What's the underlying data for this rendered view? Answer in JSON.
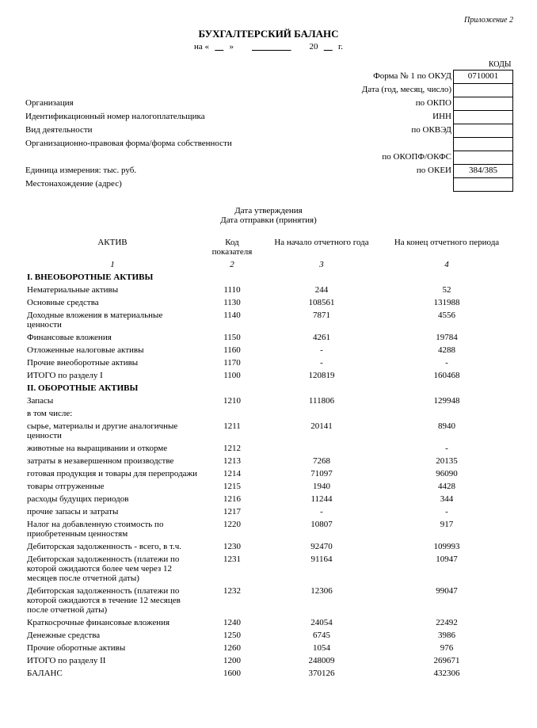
{
  "priloz": "Приложение 2",
  "title": "БУХГАЛТЕРСКИЙ БАЛАНС",
  "date_line_prefix": "на «",
  "date_line_day": "",
  "date_line_mid": "»",
  "date_line_month": "",
  "date_line_year_prefix": "20",
  "date_line_year_suffix": "г.",
  "codes_label": "КОДЫ",
  "meta_rows": [
    {
      "left": "",
      "mid": "Форма № 1 по ОКУД",
      "code": "0710001"
    },
    {
      "left": "",
      "mid": "Дата (год, месяц, число)",
      "code": ""
    },
    {
      "left": "Организация",
      "mid": "по ОКПО",
      "code": ""
    },
    {
      "left": "Идентификационный номер налогоплательщика",
      "mid": "ИНН",
      "code": ""
    },
    {
      "left": "Вид деятельности",
      "mid": "по ОКВЭД",
      "code": ""
    },
    {
      "left": "Организационно-правовая форма/форма собственности",
      "mid": "",
      "code": ""
    },
    {
      "left": "",
      "mid": "по ОКОПФ/ОКФС",
      "code": ""
    },
    {
      "left": "Единица измерения: тыс. руб.",
      "mid": "по ОКЕИ",
      "code": "384/385"
    },
    {
      "left": "Местонахождение (адрес)",
      "mid": "",
      "code": ""
    }
  ],
  "approve_1": "Дата утверждения",
  "approve_2": "Дата отправки (принятия)",
  "columns": {
    "c1": "АКТИВ",
    "c2": "Код показателя",
    "c3": "На начало отчетного года",
    "c4": "На конец отчетного периода"
  },
  "colnums": {
    "c1": "1",
    "c2": "2",
    "c3": "3",
    "c4": "4"
  },
  "section1_title": "I. ВНЕОБОРОТНЫЕ АКТИВЫ",
  "rows_s1": [
    {
      "name": "Нематериальные активы",
      "code": "1110",
      "v1": "244",
      "v2": "52"
    },
    {
      "name": "Основные средства",
      "code": "1130",
      "v1": "108561",
      "v2": "131988"
    },
    {
      "name": "Доходные вложения в материальные ценности",
      "code": "1140",
      "v1": "7871",
      "v2": "4556"
    },
    {
      "name": "Финансовые вложения",
      "code": "1150",
      "v1": "4261",
      "v2": "19784"
    },
    {
      "name": "Отложенные налоговые активы",
      "code": "1160",
      "v1": "-",
      "v2": "4288"
    },
    {
      "name": "Прочие внеоборотные активы",
      "code": "1170",
      "v1": "-",
      "v2": "-"
    }
  ],
  "itog1": {
    "name": "ИТОГО по разделу I",
    "code": "1100",
    "v1": "120819",
    "v2": "160468"
  },
  "section2_title": "II. ОБОРОТНЫЕ АКТИВЫ",
  "rows_s2a": [
    {
      "name": "Запасы",
      "code": "1210",
      "v1": "111806",
      "v2": "129948",
      "bold": false
    },
    {
      "name": "в том числе:",
      "code": "",
      "v1": "",
      "v2": "",
      "indent": 2
    },
    {
      "name": "сырье, материалы и другие аналогичные ценности",
      "code": "1211",
      "v1": "20141",
      "v2": "8940",
      "indent": 2
    },
    {
      "name": "животные на выращивании и откорме",
      "code": "1212",
      "v1": "",
      "v2": "-",
      "indent": 2
    },
    {
      "name": "затраты в незавершенном производстве",
      "code": "1213",
      "v1": "7268",
      "v2": "20135",
      "indent": 2
    },
    {
      "name": "готовая продукция и товары для перепродажи",
      "code": "1214",
      "v1": "71097",
      "v2": "96090",
      "indent": 2
    },
    {
      "name": "товары отгруженные",
      "code": "1215",
      "v1": "1940",
      "v2": "4428",
      "indent": 2
    },
    {
      "name": "расходы будущих периодов",
      "code": "1216",
      "v1": "11244",
      "v2": "344",
      "indent": 2
    },
    {
      "name": "прочие запасы и затраты",
      "code": "1217",
      "v1": "-",
      "v2": "-",
      "indent": 2
    }
  ],
  "rows_s2b": [
    {
      "name": "Налог на добавленную стоимость по приобретенным ценностям",
      "code": "1220",
      "v1": "10807",
      "v2": "917"
    }
  ],
  "rows_s2c": [
    {
      "name": "Дебиторская задолженность - всего, в т.ч.",
      "code": "1230",
      "v1": "92470",
      "v2": "109993"
    }
  ],
  "rows_s2d": [
    {
      "name": "Дебиторская задолженность (платежи по которой ожидаются более чем через 12 месяцев после отчетной даты)",
      "code": "1231",
      "v1": "91164",
      "v2": "10947"
    }
  ],
  "rows_s2e": [
    {
      "name": "Дебиторская задолженность (платежи по которой ожидаются в течение 12 месяцев после отчетной даты)",
      "code": "1232",
      "v1": "12306",
      "v2": "99047"
    },
    {
      "name": "Краткосрочные финансовые вложения",
      "code": "1240",
      "v1": "24054",
      "v2": "22492"
    },
    {
      "name": "Денежные средства",
      "code": "1250",
      "v1": "6745",
      "v2": "3986"
    },
    {
      "name": "Прочие оборотные активы",
      "code": "1260",
      "v1": "1054",
      "v2": "976"
    }
  ],
  "itog2": {
    "name": "ИТОГО по разделу II",
    "code": "1200",
    "v1": "248009",
    "v2": "269671"
  },
  "balans": {
    "name": "БАЛАНС",
    "code": "1600",
    "v1": "370126",
    "v2": "432306"
  }
}
